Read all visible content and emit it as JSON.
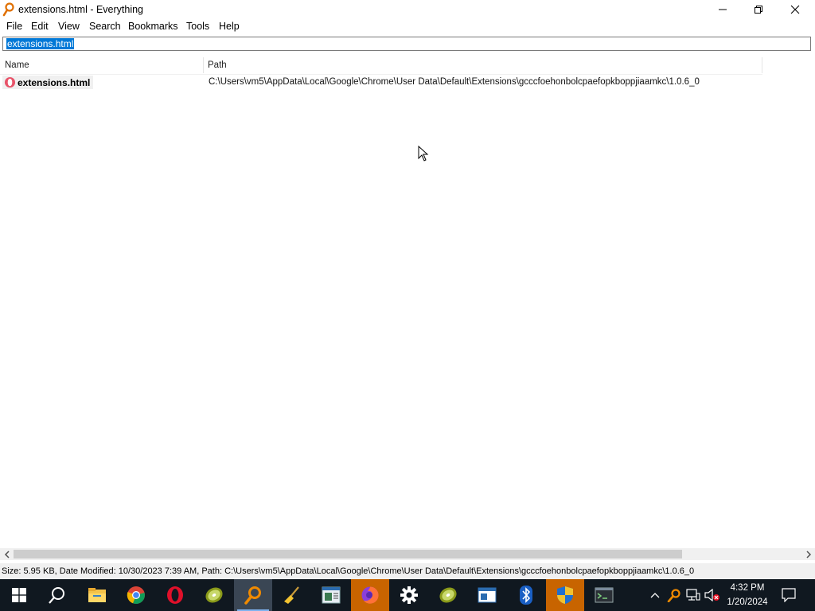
{
  "window": {
    "title": "extensions.html - Everything",
    "app_icon": "magnifier-icon",
    "controls": [
      "minimize-icon",
      "restore-icon",
      "close-icon"
    ]
  },
  "menu": [
    "File",
    "Edit",
    "View",
    "Search",
    "Bookmarks",
    "Tools",
    "Help"
  ],
  "search": {
    "value": "extensions.html"
  },
  "columns": [
    "Name",
    "Path"
  ],
  "results": [
    {
      "name": "extensions.html",
      "path": "C:\\Users\\vm5\\AppData\\Local\\Google\\Chrome\\User Data\\Default\\Extensions\\gcccfoehonbolcpaefopkboppjiaamkc\\1.0.6_0",
      "icon": "opera-html-icon"
    }
  ],
  "status": "Size: 5.95 KB, Date Modified: 10/30/2023 7:39 AM, Path: C:\\Users\\vm5\\AppData\\Local\\Google\\Chrome\\User Data\\Default\\Extensions\\gcccfoehonbolcpaefopkboppjiaamkc\\1.0.6_0",
  "taskbar": {
    "apps": [
      "windows-start-icon",
      "search-icon",
      "file-explorer-icon",
      "chrome-icon",
      "opera-icon",
      "kiwi-icon",
      "everything-icon",
      "ccleaner-icon",
      "notepad-icon",
      "firefox-icon",
      "settings-icon",
      "kiwi-icon",
      "app-window-icon",
      "bluetooth-icon",
      "shield-icon",
      "terminal-icon"
    ],
    "tray": [
      "chevron-up-icon",
      "everything-tray-icon",
      "network-icon",
      "volume-muted-icon",
      "notification-icon"
    ],
    "time": "4:32 PM",
    "date": "1/20/2024"
  },
  "colors": {
    "selection": "#0078d7",
    "taskbar": "#101820",
    "highlight": "#c86400"
  }
}
